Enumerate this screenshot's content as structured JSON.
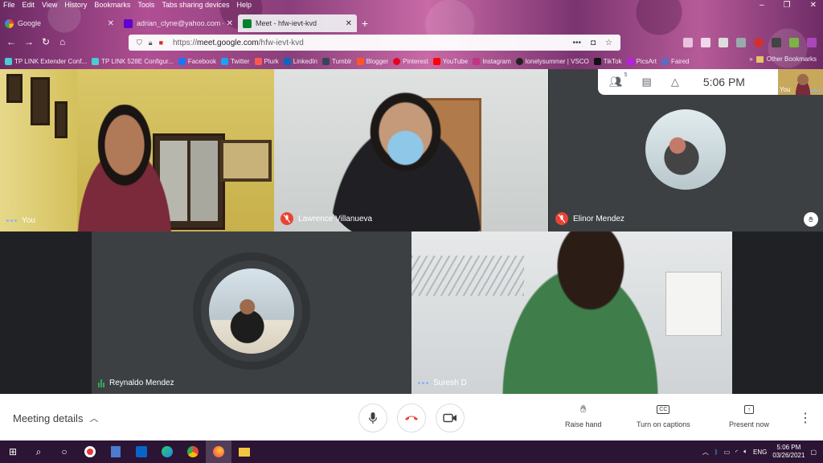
{
  "browser": {
    "menu": [
      "File",
      "Edit",
      "View",
      "History",
      "Bookmarks",
      "Tools",
      "Tabs sharing devices",
      "Help"
    ],
    "tabs": [
      {
        "label": "Google",
        "active": false
      },
      {
        "label": "adrian_clyne@yahoo.com - Ya...",
        "active": false
      },
      {
        "label": "Meet - hfw-ievt-kvd",
        "active": true
      }
    ],
    "url_prefix": "https://",
    "url_host": "meet.google.com",
    "url_path": "/hfw-ievt-kvd",
    "bookmarks": [
      "TP LINK Extender Conf...",
      "TP LINK 528E Configur...",
      "Facebook",
      "Twitter",
      "Plurk",
      "LinkedIn",
      "Tumblr",
      "Blogger",
      "Pinterest",
      "YouTube",
      "Instagram",
      "lonelysummer | VSCO",
      "TikTok",
      "PicsArt",
      "Faired"
    ],
    "other_bookmarks": "Other Bookmarks"
  },
  "meet": {
    "clock": "5:06 PM",
    "participant_count": "5",
    "self_label": "You",
    "participants": [
      {
        "name": "You",
        "muted": false,
        "speaking": true
      },
      {
        "name": "Lawrence Villanueva",
        "muted": true
      },
      {
        "name": "Elinor Mendez",
        "muted": true
      },
      {
        "name": "Reynaldo Mendez",
        "muted": false,
        "speaking": true
      },
      {
        "name": "Suresh D",
        "muted": false
      }
    ],
    "bottom": {
      "meeting_details": "Meeting details",
      "raise_hand": "Raise hand",
      "captions": "Turn on captions",
      "present": "Present now"
    }
  },
  "taskbar": {
    "lang": "ENG",
    "time": "5:06 PM",
    "date": "03/26/2021"
  },
  "colors": {
    "meet_bg": "#202124",
    "end_call": "#ea4335",
    "muted_badge": "#ea4335",
    "speaking_dots": "#8ab4f8"
  }
}
